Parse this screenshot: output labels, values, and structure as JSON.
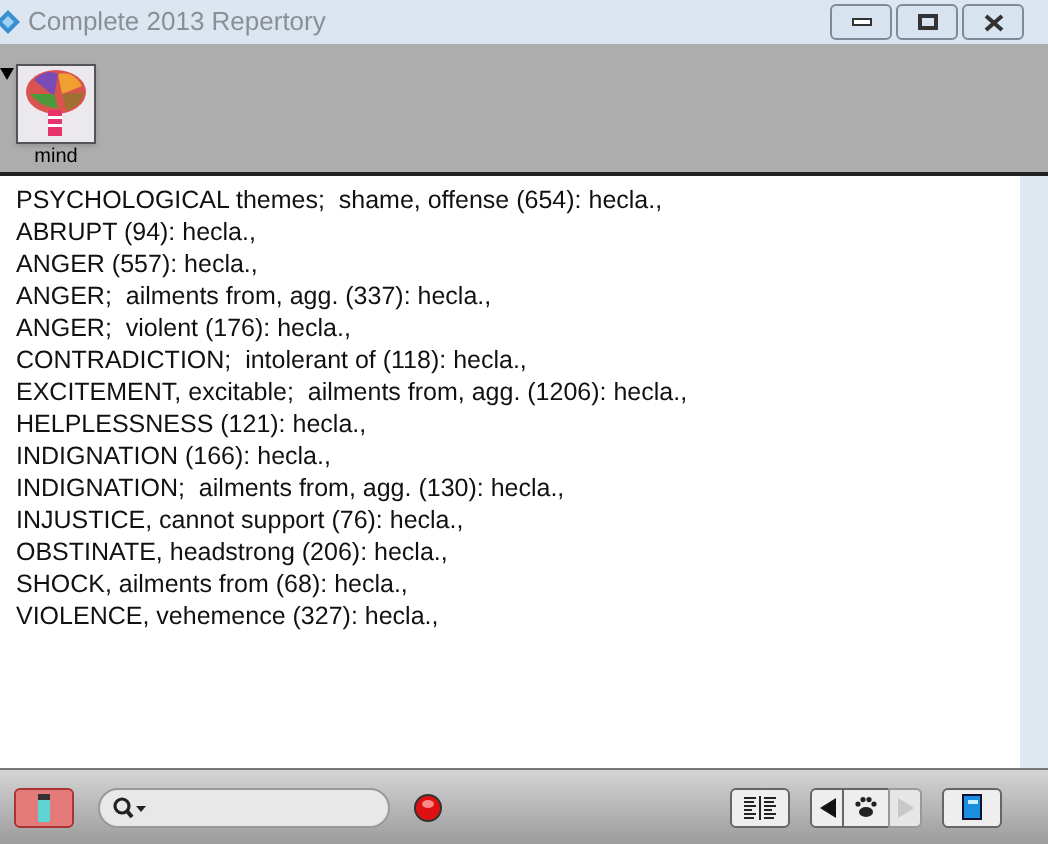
{
  "window": {
    "title": "Complete 2013 Repertory"
  },
  "toolbar": {
    "items": [
      {
        "label": "mind"
      }
    ]
  },
  "rubrics": [
    "PSYCHOLOGICAL themes;  shame, offense (654): hecla.,",
    "ABRUPT (94): hecla.,",
    "ANGER (557): hecla.,",
    "ANGER;  ailments from, agg. (337): hecla.,",
    "ANGER;  violent (176): hecla.,",
    "CONTRADICTION;  intolerant of (118): hecla.,",
    "EXCITEMENT, excitable;  ailments from, agg. (1206): hecla.,",
    "HELPLESSNESS (121): hecla.,",
    "INDIGNATION (166): hecla.,",
    "INDIGNATION;  ailments from, agg. (130): hecla.,",
    "INJUSTICE, cannot support (76): hecla.,",
    "OBSTINATE, headstrong (206): hecla.,",
    "SHOCK, ailments from (68): hecla.,",
    "VIOLENCE, vehemence (327): hecla.,"
  ]
}
